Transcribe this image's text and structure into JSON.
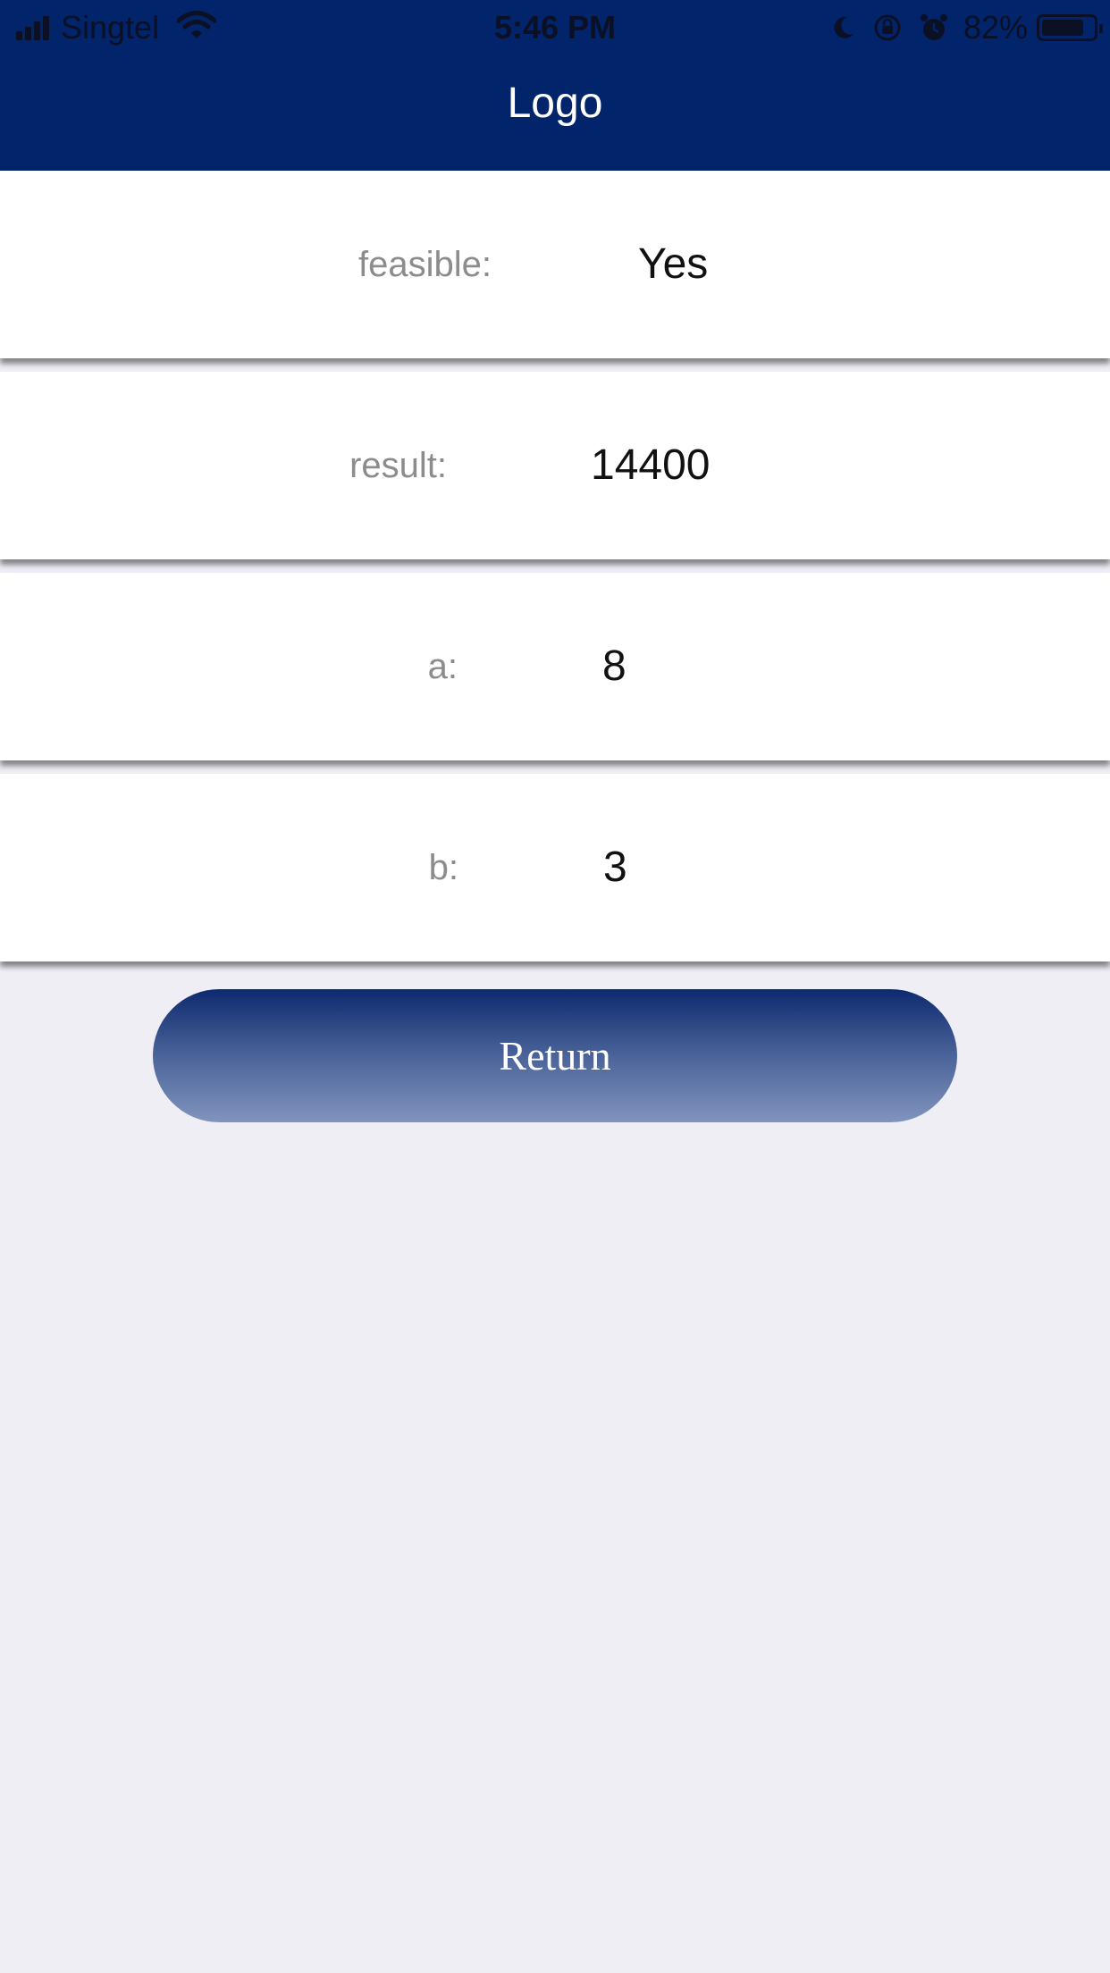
{
  "status_bar": {
    "carrier": "Singtel",
    "time": "5:46 PM",
    "battery_percent": "82%",
    "battery_level": 0.82,
    "icons": [
      "signal-icon",
      "wifi-icon",
      "moon-icon",
      "rotation-lock-icon",
      "alarm-icon",
      "battery-icon"
    ]
  },
  "header": {
    "title": "Logo",
    "background": "#01246b"
  },
  "results": [
    {
      "label": "feasible:",
      "value": "Yes"
    },
    {
      "label": "result:",
      "value": "14400"
    },
    {
      "label": "a:",
      "value": "8"
    },
    {
      "label": "b:",
      "value": "3"
    }
  ],
  "actions": {
    "return_label": "Return"
  }
}
